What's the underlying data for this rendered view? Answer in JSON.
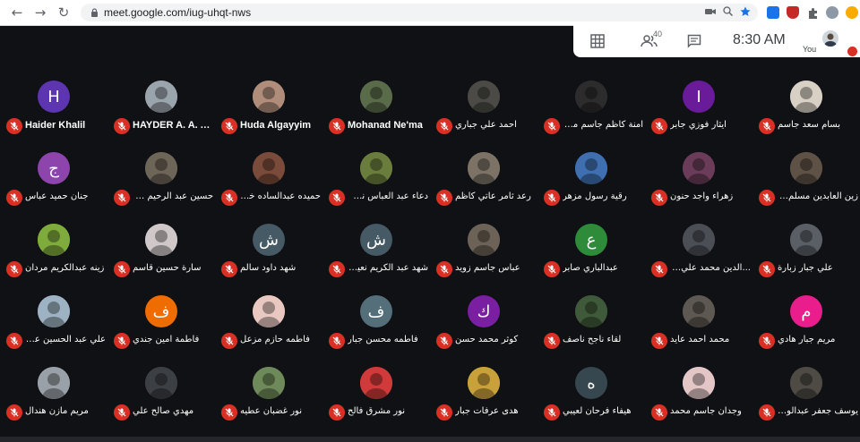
{
  "browser": {
    "url": "meet.google.com/iug-uhqt-nws",
    "back_icon": "←",
    "forward_icon": "→",
    "reload_icon": "↻"
  },
  "meet": {
    "people_count": "40",
    "time": "8:30 AM",
    "you_label": "You",
    "accent_mute": "#d93025"
  },
  "participants": [
    {
      "name": "Haider Khalil",
      "avatar_letter": "H",
      "avatar_color": "#5e35b1",
      "latin": true
    },
    {
      "name": "HAYDER A. A. A...",
      "avatar_letter": "",
      "avatar_color": "#9aa4ad",
      "latin": true
    },
    {
      "name": "Huda Algayyim",
      "avatar_letter": "",
      "avatar_color": "#b08c7a",
      "latin": true
    },
    {
      "name": "Mohanad Ne'ma",
      "avatar_letter": "",
      "avatar_color": "#5a6b4a",
      "latin": true
    },
    {
      "name": "احمد علي جباري",
      "avatar_letter": "",
      "avatar_color": "#4b4a46",
      "latin": false
    },
    {
      "name": "امنة كاظم جاسم محمد",
      "avatar_letter": "",
      "avatar_color": "#2c2c2c",
      "latin": false
    },
    {
      "name": "ايثار فوزي جابر",
      "avatar_letter": "I",
      "avatar_color": "#6a1b9a",
      "latin": false
    },
    {
      "name": "بسام سعد جاسم",
      "avatar_letter": "",
      "avatar_color": "#d8d0c4",
      "latin": false
    },
    {
      "name": "جنان حميد عباس",
      "avatar_letter": "ج",
      "avatar_color": "#8e44ad",
      "latin": false
    },
    {
      "name": "حسين عبد الرحيم موسى",
      "avatar_letter": "",
      "avatar_color": "#6d6558",
      "latin": false
    },
    {
      "name": "حميده عبدالساده خيرالله",
      "avatar_letter": "",
      "avatar_color": "#7a4b3a",
      "latin": false
    },
    {
      "name": "دعاء عبد العباس نجف",
      "avatar_letter": "",
      "avatar_color": "#6b7d3c",
      "latin": false
    },
    {
      "name": "رعد ثامر عاتي كاظم",
      "avatar_letter": "",
      "avatar_color": "#7c7366",
      "latin": false
    },
    {
      "name": "رقية رسول مزهر",
      "avatar_letter": "",
      "avatar_color": "#3f6fb0",
      "latin": false
    },
    {
      "name": "زهراء واجد حنون",
      "avatar_letter": "",
      "avatar_color": "#6a3c5a",
      "latin": false
    },
    {
      "name": "زين العابدين مسلم محسن",
      "avatar_letter": "",
      "avatar_color": "#5e5246",
      "latin": false
    },
    {
      "name": "زينه عبدالكريم مردان",
      "avatar_letter": "",
      "avatar_color": "#7faa3c",
      "latin": false
    },
    {
      "name": "سارة حسين قاسم",
      "avatar_letter": "",
      "avatar_color": "#d0c8c8",
      "latin": false
    },
    {
      "name": "شهد داود سالم",
      "avatar_letter": "ش",
      "avatar_color": "#455a64",
      "latin": false
    },
    {
      "name": "شهد عبد الكريم نعيش",
      "avatar_letter": "ش",
      "avatar_color": "#455a64",
      "latin": false
    },
    {
      "name": "عباس جاسم زويد",
      "avatar_letter": "",
      "avatar_color": "#6c6257",
      "latin": false
    },
    {
      "name": "عبدالباري صابر",
      "avatar_letter": "ع",
      "avatar_color": "#2e8b3a",
      "latin": false
    },
    {
      "name": "...الدين محمد علي عبدالله",
      "avatar_letter": "",
      "avatar_color": "#4b4e55",
      "latin": false
    },
    {
      "name": "علي جبار زبارة",
      "avatar_letter": "",
      "avatar_color": "#5a5f66",
      "latin": false
    },
    {
      "name": "علي عبد الحسين علي",
      "avatar_letter": "",
      "avatar_color": "#9db2c2",
      "latin": false
    },
    {
      "name": "فاطمة امين جندي",
      "avatar_letter": "ف",
      "avatar_color": "#ef6c00",
      "latin": false
    },
    {
      "name": "فاطمه حازم مزعل",
      "avatar_letter": "",
      "avatar_color": "#e8c8c0",
      "latin": false
    },
    {
      "name": "فاطمه محسن جبار",
      "avatar_letter": "ف",
      "avatar_color": "#546e7a",
      "latin": false
    },
    {
      "name": "كوثر محمد حسن",
      "avatar_letter": "ك",
      "avatar_color": "#7b1fa2",
      "latin": false
    },
    {
      "name": "لقاء ناجح ناصف",
      "avatar_letter": "",
      "avatar_color": "#3f5a3a",
      "latin": false
    },
    {
      "name": "محمد احمد عايد",
      "avatar_letter": "",
      "avatar_color": "#5d5852",
      "latin": false
    },
    {
      "name": "مريم جبار هادي",
      "avatar_letter": "م",
      "avatar_color": "#e91e8c",
      "latin": false
    },
    {
      "name": "مريم مازن هندال",
      "avatar_letter": "",
      "avatar_color": "#9aa0a8",
      "latin": false
    },
    {
      "name": "مهدي صالح علي",
      "avatar_letter": "",
      "avatar_color": "#3c3f44",
      "latin": false
    },
    {
      "name": "نور غضبان عطيه",
      "avatar_letter": "",
      "avatar_color": "#6f8a5a",
      "latin": false
    },
    {
      "name": "نور مشرق فالح",
      "avatar_letter": "",
      "avatar_color": "#d03a3a",
      "latin": false
    },
    {
      "name": "هدى عرفات جبار",
      "avatar_letter": "",
      "avatar_color": "#c9a13a",
      "latin": false
    },
    {
      "name": "هيفاء فرحان لعيبي",
      "avatar_letter": "ه",
      "avatar_color": "#37474f",
      "latin": false
    },
    {
      "name": "وجدان جاسم محمد",
      "avatar_letter": "",
      "avatar_color": "#e4c6c6",
      "latin": false
    },
    {
      "name": "يوسف جعفر عبدالواحد",
      "avatar_letter": "",
      "avatar_color": "#4e4a44",
      "latin": false
    }
  ]
}
